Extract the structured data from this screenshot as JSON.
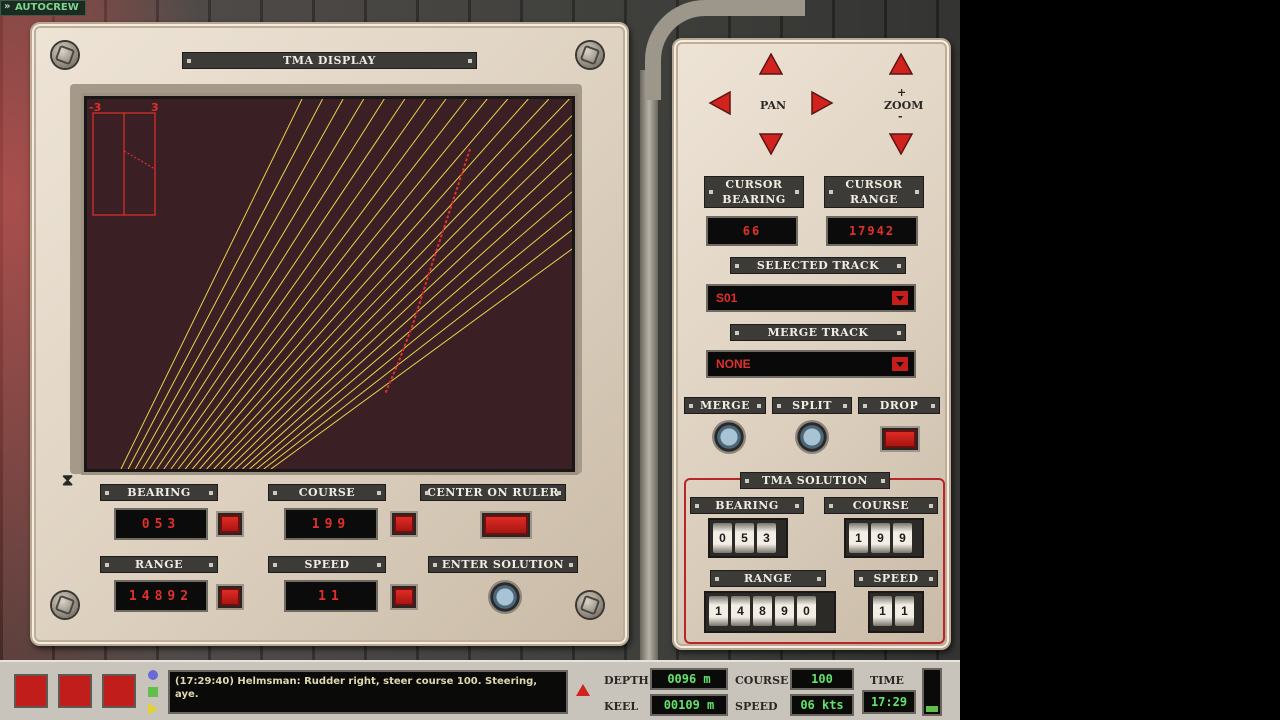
{
  "top_tag": "AUTOCREW",
  "tma": {
    "title": "TMA DISPLAY",
    "scale_left": "-3",
    "scale_right": "3",
    "bearing_label": "BEARING",
    "bearing_value": "053",
    "course_label": "COURSE",
    "course_value": "199",
    "range_label": "RANGE",
    "range_value": "14892",
    "speed_label": "SPEED",
    "speed_value": "11",
    "center_on_ruler": "CENTER ON RULER",
    "enter_solution": "ENTER SOLUTION",
    "colors": {
      "bearing_lines": "#e8d24a",
      "track": "#e0312a",
      "screen": "#3a1f24"
    }
  },
  "controls": {
    "pan_label": "PAN",
    "zoom_plus": "+",
    "zoom_label": "ZOOM",
    "zoom_minus": "-",
    "cursor_bearing_line1": "CURSOR",
    "cursor_bearing_line2": "BEARING",
    "cursor_bearing_value": "66",
    "cursor_range_line1": "CURSOR",
    "cursor_range_line2": "RANGE",
    "cursor_range_value": "17942",
    "selected_track_label": "SELECTED TRACK",
    "selected_track_value": "S01",
    "merge_track_label": "MERGE TRACK",
    "merge_track_value": "NONE",
    "merge": "MERGE",
    "split": "SPLIT",
    "drop": "DROP"
  },
  "solution": {
    "title": "TMA SOLUTION",
    "bearing_label": "BEARING",
    "bearing_digits": [
      "0",
      "5",
      "3"
    ],
    "course_label": "COURSE",
    "course_digits": [
      "1",
      "9",
      "9"
    ],
    "range_label": "RANGE",
    "range_digits": [
      "1",
      "4",
      "8",
      "9",
      "0"
    ],
    "speed_label": "SPEED",
    "speed_digits": [
      "1",
      "1"
    ]
  },
  "status_bar": {
    "message": "(17:29:40) Helmsman: Rudder right, steer course 100. Steering, aye.",
    "depth_label": "DEPTH",
    "depth_value": "0096 m",
    "keel_label": "KEEL",
    "keel_value": "00109 m",
    "course_label": "COURSE",
    "course_value": "100",
    "speed_label": "SPEED",
    "speed_value": "06 kts",
    "time_label": "TIME",
    "time_value": "17:29"
  }
}
